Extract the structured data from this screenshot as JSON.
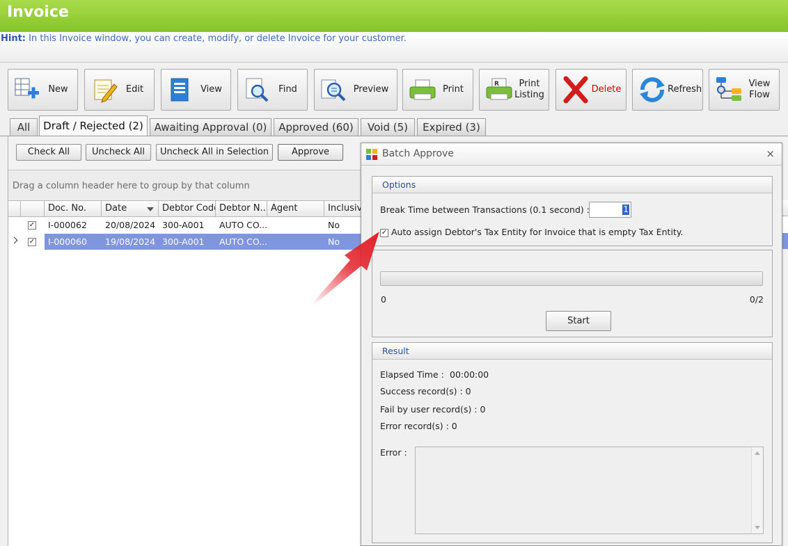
{
  "window": {
    "title": "Invoice"
  },
  "hint": {
    "label": "Hint:",
    "text": "In this Invoice window, you can create, modify, or delete Invoice for your customer."
  },
  "toolbar": {
    "new": "New",
    "edit": "Edit",
    "view": "View",
    "find": "Find",
    "preview": "Preview",
    "print": "Print",
    "print_listing_1": "Print",
    "print_listing_2": "Listing",
    "delete": "Delete",
    "refresh": "Refresh",
    "view_flow_1": "View",
    "view_flow_2": "Flow",
    "delete_color": "#d00000"
  },
  "tabs": {
    "all": "All",
    "draft": "Draft / Rejected (2)",
    "awaiting": "Awaiting Approval (0)",
    "approved": "Approved (60)",
    "void": "Void (5)",
    "expired": "Expired (3)"
  },
  "actions": {
    "check_all": "Check All",
    "uncheck_all": "Uncheck All",
    "uncheck_sel": "Uncheck All in Selection",
    "approve": "Approve"
  },
  "grid": {
    "group_hint": "Drag a column header here to group by that column",
    "columns": [
      "Doc. No.",
      "Date",
      "Debtor Code",
      "Debtor N...",
      "Agent",
      "Inclusive"
    ],
    "rows": [
      {
        "doc": "I-000062",
        "date": "20/08/2024",
        "code": "300-A001",
        "name": "AUTO CO...",
        "agent": "",
        "inclusive": "No"
      },
      {
        "doc": "I-000060",
        "date": "19/08/2024",
        "code": "300-A001",
        "name": "AUTO CO...",
        "agent": "",
        "inclusive": "No"
      }
    ],
    "selection_color": "#7f95e0"
  },
  "dialog": {
    "title": "Batch Approve",
    "close": "×",
    "options_title": "Options",
    "break_label": "Break Time between Transactions (0.1 second) :",
    "break_value": "1",
    "auto_assign": "Auto assign Debtor's Tax Entity for Invoice that is empty Tax Entity.",
    "progress_min": "0",
    "progress_count": "0/2",
    "progress_fraction": 0,
    "start": "Start",
    "result_title": "Result",
    "elapsed_label": "Elapsed Time :",
    "elapsed_value": "00:00:00",
    "success": "Success record(s) : 0",
    "fail": "Fail by user record(s) : 0",
    "error_records": "Error record(s) : 0",
    "error_label": "Error :"
  },
  "colors": {
    "title_bar": "#96cf35",
    "hint_text": "#3c68c2",
    "group_title": "#2a4c9e",
    "arrow": "#e3222a"
  }
}
